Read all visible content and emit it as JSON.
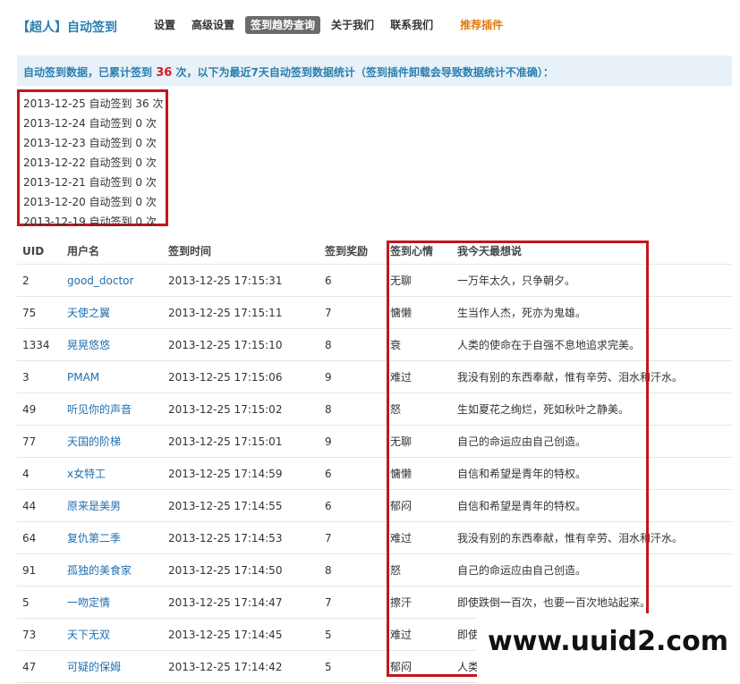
{
  "header": {
    "brand": "【超人】自动签到",
    "nav": [
      {
        "label": "设置"
      },
      {
        "label": "高级设置"
      },
      {
        "label": "签到趋势查询",
        "active": true
      },
      {
        "label": "关于我们"
      },
      {
        "label": "联系我们"
      }
    ],
    "recommend": "推荐插件"
  },
  "notice": {
    "prefix": "自动签到数据，已累计签到",
    "count": "36",
    "suffix": "次，以下为最近7天自动签到数据统计（签到插件卸载会导致数据统计不准确）："
  },
  "stats": [
    "2013-12-25 自动签到 36 次",
    "2013-12-24 自动签到 0 次",
    "2013-12-23 自动签到 0 次",
    "2013-12-22 自动签到 0 次",
    "2013-12-21 自动签到 0 次",
    "2013-12-20 自动签到 0 次",
    "2013-12-19 自动签到 0 次"
  ],
  "table": {
    "headers": {
      "uid": "UID",
      "user": "用户名",
      "time": "签到时间",
      "reward": "签到奖励",
      "mood": "签到心情",
      "say": "我今天最想说"
    },
    "rows": [
      {
        "uid": "2",
        "user": "good_doctor",
        "time": "2013-12-25 17:15:31",
        "reward": "6",
        "mood": "无聊",
        "say": "一万年太久，只争朝夕。"
      },
      {
        "uid": "75",
        "user": "天使之翼",
        "time": "2013-12-25 17:15:11",
        "reward": "7",
        "mood": "慵懒",
        "say": "生当作人杰，死亦为鬼雄。"
      },
      {
        "uid": "1334",
        "user": "晃晃悠悠",
        "time": "2013-12-25 17:15:10",
        "reward": "8",
        "mood": "衰",
        "say": "人类的使命在于自强不息地追求完美。"
      },
      {
        "uid": "3",
        "user": "PMAM",
        "time": "2013-12-25 17:15:06",
        "reward": "9",
        "mood": "难过",
        "say": "我没有别的东西奉献，惟有辛劳、泪水和汗水。"
      },
      {
        "uid": "49",
        "user": "听见你的声音",
        "time": "2013-12-25 17:15:02",
        "reward": "8",
        "mood": "怒",
        "say": "生如夏花之绚烂，死如秋叶之静美。"
      },
      {
        "uid": "77",
        "user": "天国的阶梯",
        "time": "2013-12-25 17:15:01",
        "reward": "9",
        "mood": "无聊",
        "say": "自己的命运应由自己创造。"
      },
      {
        "uid": "4",
        "user": "x女特工",
        "time": "2013-12-25 17:14:59",
        "reward": "6",
        "mood": "慵懒",
        "say": "自信和希望是青年的特权。"
      },
      {
        "uid": "44",
        "user": "原来是美男",
        "time": "2013-12-25 17:14:55",
        "reward": "6",
        "mood": "郁闷",
        "say": "自信和希望是青年的特权。"
      },
      {
        "uid": "64",
        "user": "复仇第二季",
        "time": "2013-12-25 17:14:53",
        "reward": "7",
        "mood": "难过",
        "say": "我没有别的东西奉献，惟有辛劳、泪水和汗水。"
      },
      {
        "uid": "91",
        "user": "孤独的美食家",
        "time": "2013-12-25 17:14:50",
        "reward": "8",
        "mood": "怒",
        "say": "自己的命运应由自己创造。"
      },
      {
        "uid": "5",
        "user": "一吻定情",
        "time": "2013-12-25 17:14:47",
        "reward": "7",
        "mood": "擦汗",
        "say": "即使跌倒一百次，也要一百次地站起来。"
      },
      {
        "uid": "73",
        "user": "天下无双",
        "time": "2013-12-25 17:14:45",
        "reward": "5",
        "mood": "难过",
        "say": "即使"
      },
      {
        "uid": "47",
        "user": "可疑的保姆",
        "time": "2013-12-25 17:14:42",
        "reward": "5",
        "mood": "郁闷",
        "say": "人类"
      }
    ]
  },
  "watermark": "www.uuid2.com",
  "colors": {
    "accent": "#2a7fb0",
    "highlight": "#c4161c",
    "notice_bg": "#e8f1f7",
    "recommend": "#e07a10"
  }
}
